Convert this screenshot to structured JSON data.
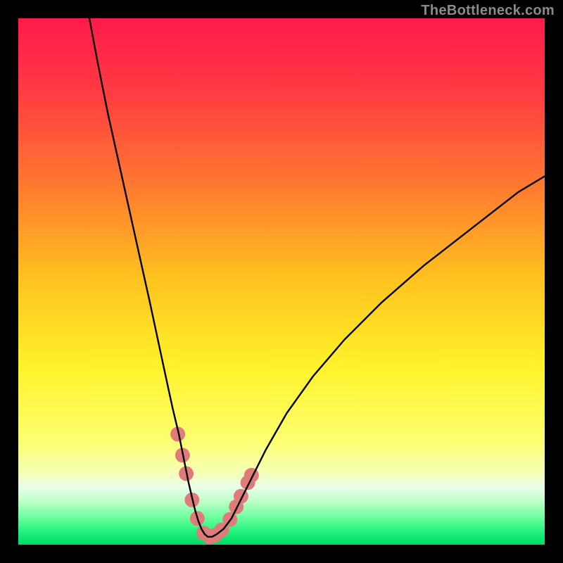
{
  "watermark": "TheBottleneck.com",
  "chart_data": {
    "type": "line",
    "title": "",
    "xlabel": "",
    "ylabel": "",
    "xlim": [
      0,
      100
    ],
    "ylim": [
      0,
      100
    ],
    "grid": false,
    "legend": false,
    "background_gradient_stops": [
      {
        "pct": 0,
        "color": "#ff1a4b"
      },
      {
        "pct": 14,
        "color": "#ff3b42"
      },
      {
        "pct": 32,
        "color": "#ff7a2f"
      },
      {
        "pct": 50,
        "color": "#ffc41f"
      },
      {
        "pct": 66,
        "color": "#fff22a"
      },
      {
        "pct": 80,
        "color": "#fdff6e"
      },
      {
        "pct": 86,
        "color": "#f5ffb0"
      },
      {
        "pct": 89,
        "color": "#eaffea"
      },
      {
        "pct": 92,
        "color": "#b8ffc6"
      },
      {
        "pct": 95,
        "color": "#66ff9a"
      },
      {
        "pct": 98,
        "color": "#18ef78"
      },
      {
        "pct": 100,
        "color": "#00d965"
      }
    ],
    "series": [
      {
        "name": "bottleneck-curve",
        "color": "#000000",
        "x": [
          13.5,
          15,
          17,
          19,
          21,
          23,
          25,
          26.5,
          28,
          29.3,
          30.5,
          31.5,
          32.3,
          33,
          33.6,
          34.2,
          34.8,
          35.4,
          36,
          36.8,
          37.7,
          39,
          40.5,
          42,
          44,
          47,
          51,
          56,
          62,
          69,
          77,
          86,
          95,
          100
        ],
        "y": [
          100,
          92,
          82,
          73,
          64,
          55,
          46,
          39,
          32,
          26,
          21,
          16,
          12,
          9,
          6.5,
          4.5,
          3,
          2,
          1.5,
          1.5,
          2,
          3,
          5,
          8,
          12,
          18,
          25,
          32,
          39,
          46,
          53,
          60,
          67,
          70
        ]
      }
    ],
    "markers": {
      "name": "highlight-dots",
      "color": "#e07b7b",
      "radius_plot_units": 1.4,
      "points": [
        {
          "x": 30.3,
          "y": 21
        },
        {
          "x": 31.2,
          "y": 17
        },
        {
          "x": 31.9,
          "y": 13.5
        },
        {
          "x": 33.0,
          "y": 8.5
        },
        {
          "x": 34.0,
          "y": 5.0
        },
        {
          "x": 35.2,
          "y": 2.2
        },
        {
          "x": 36.3,
          "y": 1.5
        },
        {
          "x": 37.4,
          "y": 1.8
        },
        {
          "x": 38.6,
          "y": 2.8
        },
        {
          "x": 40.2,
          "y": 4.8
        },
        {
          "x": 41.4,
          "y": 7.2
        },
        {
          "x": 42.3,
          "y": 9.2
        },
        {
          "x": 43.6,
          "y": 11.8
        },
        {
          "x": 44.3,
          "y": 13.2
        }
      ]
    }
  }
}
